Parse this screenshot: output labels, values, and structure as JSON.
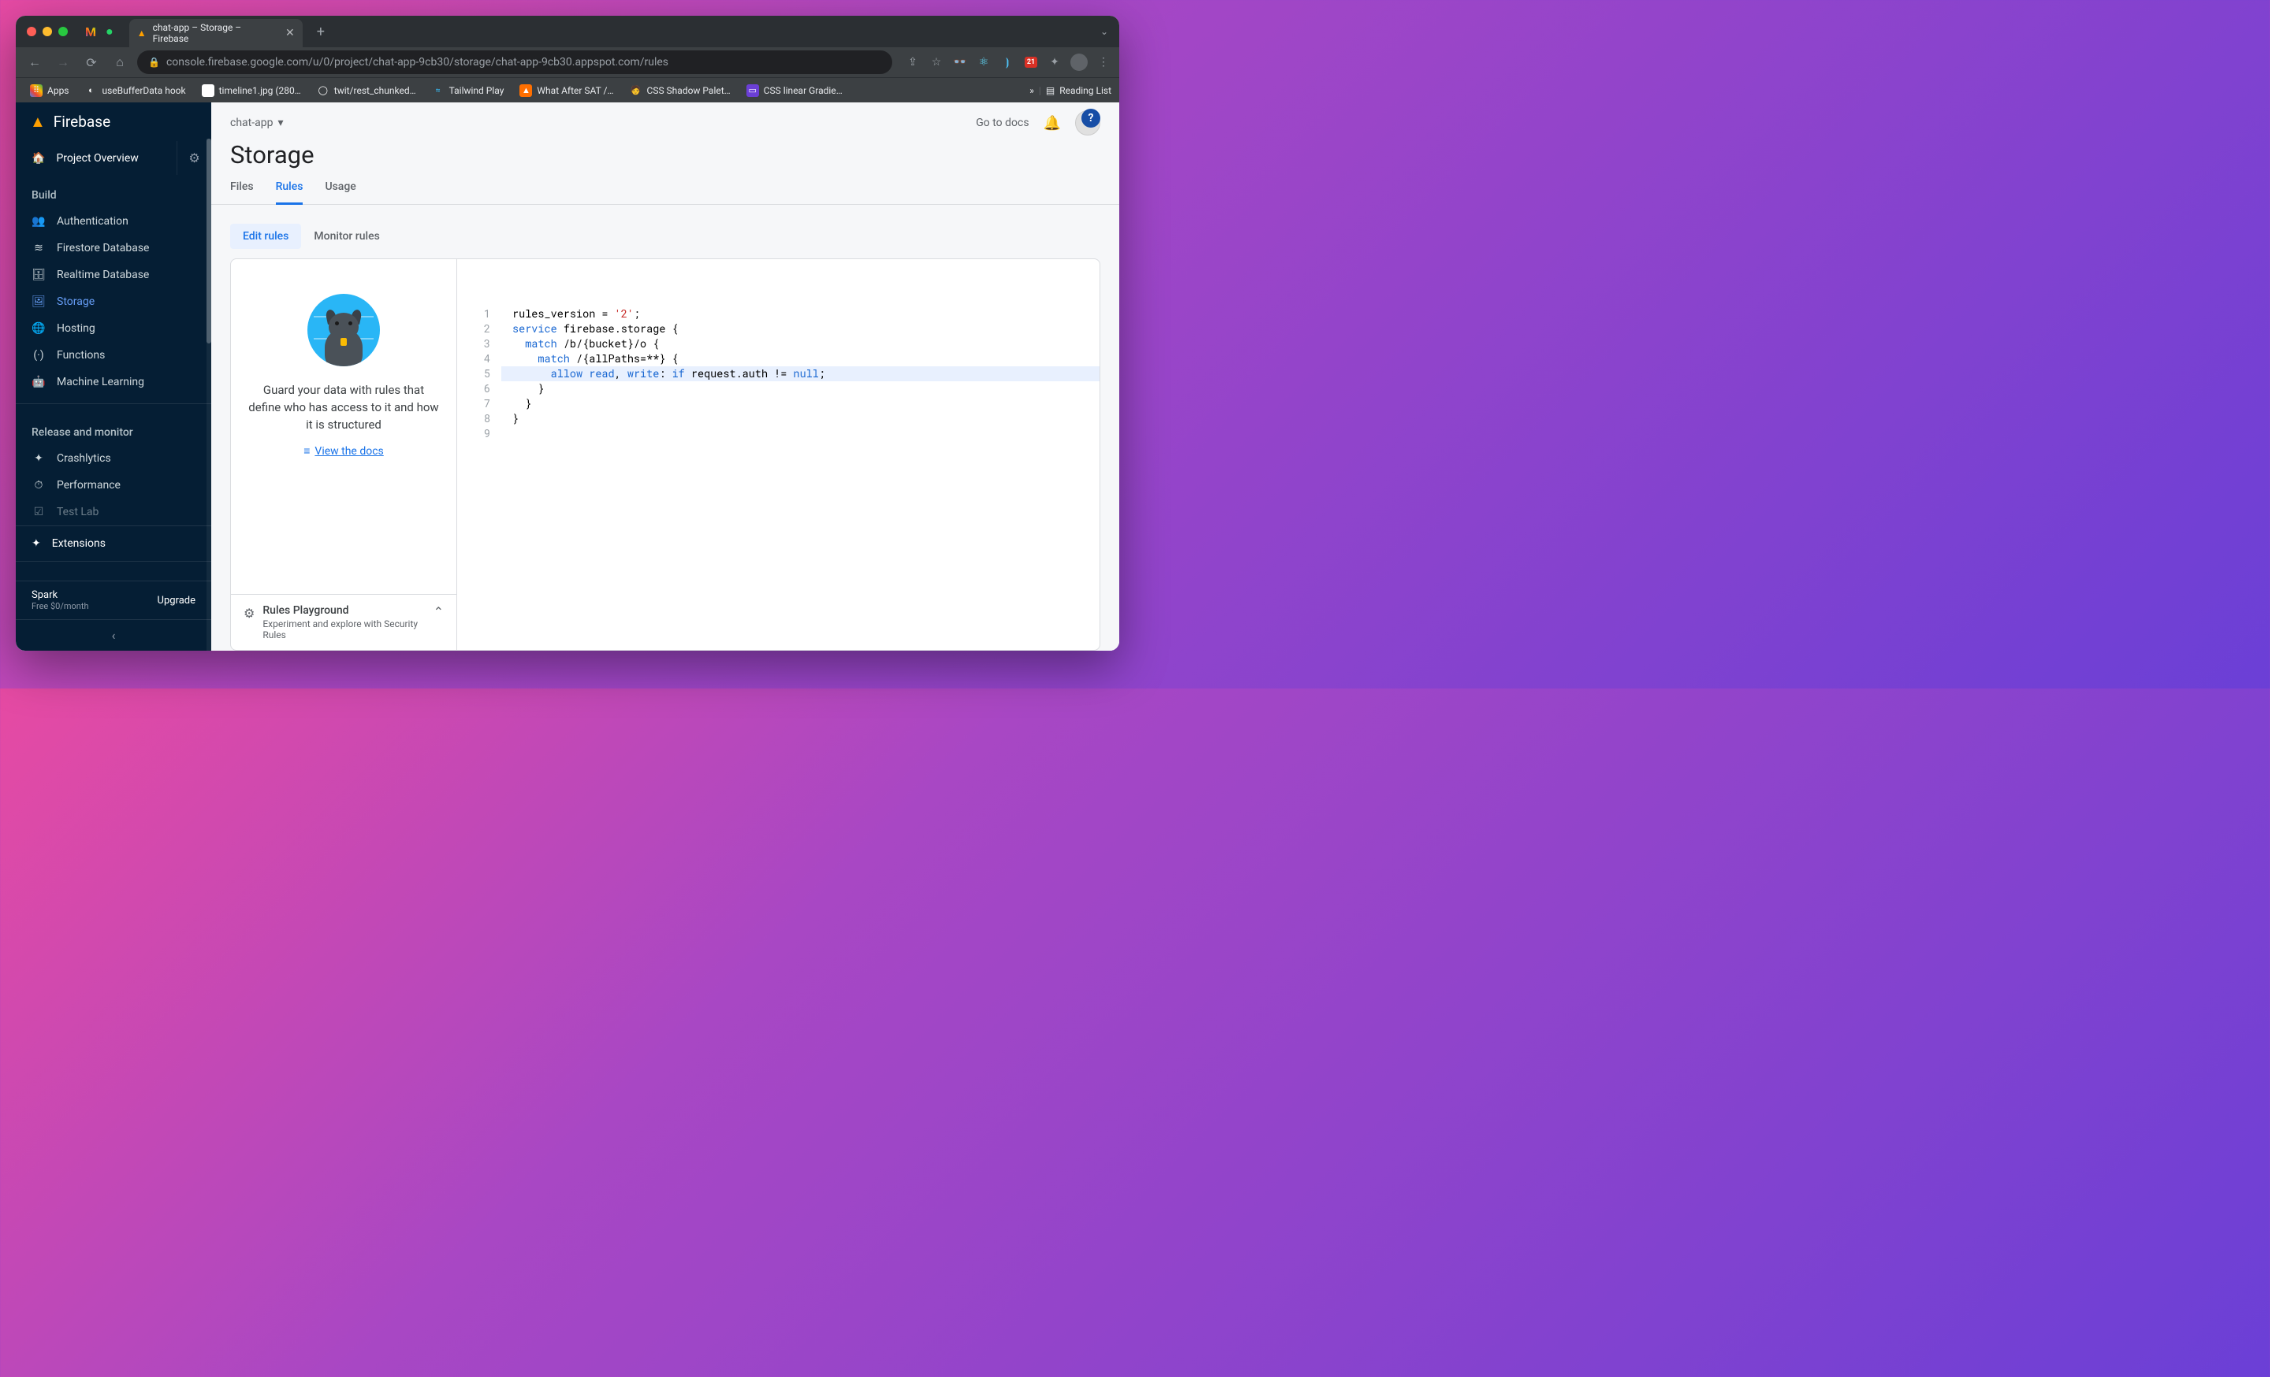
{
  "browser": {
    "tab_title": "chat-app – Storage – Firebase",
    "url": "console.firebase.google.com/u/0/project/chat-app-9cb30/storage/chat-app-9cb30.appspot.com/rules",
    "ext_badge": "21",
    "bookmarks": [
      {
        "label": "Apps"
      },
      {
        "label": "useBufferData hook"
      },
      {
        "label": "timeline1.jpg (280…"
      },
      {
        "label": "twit/rest_chunked…"
      },
      {
        "label": "Tailwind Play"
      },
      {
        "label": "What After SAT /…"
      },
      {
        "label": "CSS Shadow Palet…"
      },
      {
        "label": "CSS linear Gradie…"
      }
    ],
    "more": "»",
    "reading_list": "Reading List"
  },
  "sidebar": {
    "brand": "Firebase",
    "overview": "Project Overview",
    "build": "Build",
    "items_build": [
      {
        "icon": "👥",
        "label": "Authentication"
      },
      {
        "icon": "≋",
        "label": "Firestore Database"
      },
      {
        "icon": "🗄",
        "label": "Realtime Database"
      },
      {
        "icon": "🖼",
        "label": "Storage"
      },
      {
        "icon": "🌐",
        "label": "Hosting"
      },
      {
        "icon": "(·)",
        "label": "Functions"
      },
      {
        "icon": "🤖",
        "label": "Machine Learning"
      }
    ],
    "release": "Release and monitor",
    "items_release": [
      {
        "icon": "✦",
        "label": "Crashlytics"
      },
      {
        "icon": "⏱",
        "label": "Performance"
      },
      {
        "icon": "☑",
        "label": "Test Lab"
      }
    ],
    "extensions": "Extensions",
    "plan_name": "Spark",
    "plan_sub": "Free $0/month",
    "upgrade": "Upgrade"
  },
  "header": {
    "project": "chat-app",
    "docs": "Go to docs",
    "title": "Storage",
    "tabs": [
      "Files",
      "Rules",
      "Usage"
    ],
    "subtabs": [
      "Edit rules",
      "Monitor rules"
    ]
  },
  "left_panel": {
    "text": "Guard your data with rules that define who has access to it and how it is structured",
    "link": "View the docs",
    "pg_title": "Rules Playground",
    "pg_sub": "Experiment and explore with Security Rules"
  },
  "code": {
    "lines": [
      {
        "n": 1,
        "seg": [
          [
            "",
            "rules_version = "
          ],
          [
            "str",
            "'2'"
          ],
          [
            "",
            ";"
          ]
        ]
      },
      {
        "n": 2,
        "seg": [
          [
            "kw",
            "service"
          ],
          [
            "",
            " firebase.storage {"
          ]
        ]
      },
      {
        "n": 3,
        "seg": [
          [
            "",
            "  "
          ],
          [
            "kw",
            "match"
          ],
          [
            "",
            " /b/{bucket}/o {"
          ]
        ]
      },
      {
        "n": 4,
        "seg": [
          [
            "",
            "    "
          ],
          [
            "kw",
            "match"
          ],
          [
            "",
            " /{allPaths=**} {"
          ]
        ]
      },
      {
        "n": 5,
        "hl": true,
        "seg": [
          [
            "",
            "      "
          ],
          [
            "kw",
            "allow"
          ],
          [
            "",
            " "
          ],
          [
            "fn",
            "read"
          ],
          [
            "",
            ", "
          ],
          [
            "fn",
            "write"
          ],
          [
            "",
            ": "
          ],
          [
            "kw",
            "if"
          ],
          [
            "",
            " request.auth != "
          ],
          [
            "nul",
            "null"
          ],
          [
            "",
            ";"
          ]
        ]
      },
      {
        "n": 6,
        "seg": [
          [
            "",
            "    }"
          ]
        ]
      },
      {
        "n": 7,
        "seg": [
          [
            "",
            "  }"
          ]
        ]
      },
      {
        "n": 8,
        "seg": [
          [
            "",
            "}"
          ]
        ]
      },
      {
        "n": 9,
        "seg": [
          [
            "",
            ""
          ]
        ]
      }
    ]
  }
}
